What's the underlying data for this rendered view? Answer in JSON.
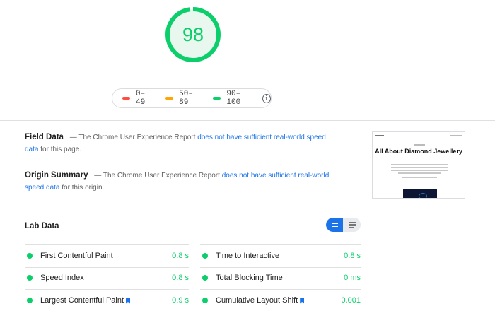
{
  "score": {
    "value": 98,
    "fraction": 0.98,
    "color": "#0cce6b"
  },
  "legend": [
    {
      "label": "0–49",
      "color": "#ff4e42"
    },
    {
      "label": "50–89",
      "color": "#ffa400"
    },
    {
      "label": "90–100",
      "color": "#0cce6b"
    }
  ],
  "field_data": {
    "title": "Field Data",
    "text_before": "— The Chrome User Experience Report",
    "link": "does not have sufficient real-world speed data",
    "text_after": "for this page."
  },
  "origin_summary": {
    "title": "Origin Summary",
    "text_before": "— The Chrome User Experience Report",
    "link": "does not have sufficient real-world speed data",
    "text_after": "for this origin."
  },
  "thumbnail": {
    "heading": "All About Diamond Jewellery"
  },
  "lab_data": {
    "title": "Lab Data",
    "metrics": [
      {
        "name": "First Contentful Paint",
        "value": "0.8 s",
        "bookmark": false
      },
      {
        "name": "Time to Interactive",
        "value": "0.8 s",
        "bookmark": false
      },
      {
        "name": "Speed Index",
        "value": "0.8 s",
        "bookmark": false
      },
      {
        "name": "Total Blocking Time",
        "value": "0 ms",
        "bookmark": false
      },
      {
        "name": "Largest Contentful Paint",
        "value": "0.9 s",
        "bookmark": true
      },
      {
        "name": "Cumulative Layout Shift",
        "value": "0.001",
        "bookmark": true
      }
    ],
    "pass_color": "#0cce6b"
  },
  "colors": {
    "accent": "#1a73e8",
    "pass": "#0cce6b",
    "average": "#ffa400",
    "fail": "#ff4e42"
  }
}
